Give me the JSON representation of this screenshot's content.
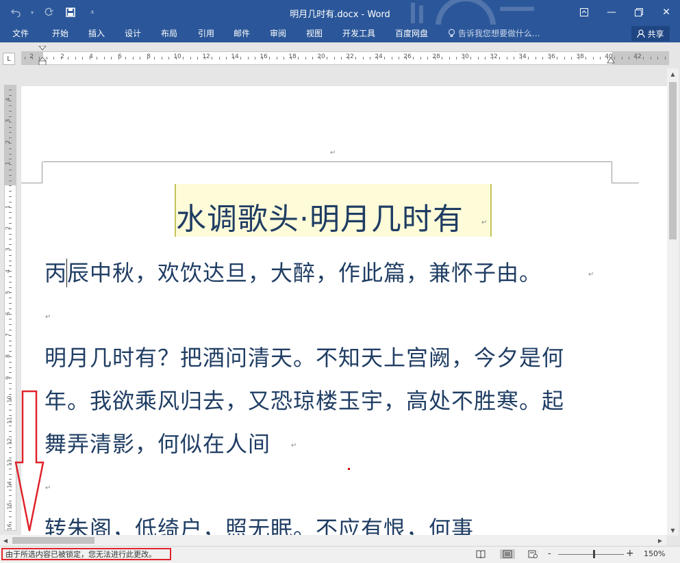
{
  "window": {
    "title": "明月几时有.docx - Word",
    "accent": "#2b579a"
  },
  "quick_access": [
    {
      "name": "undo",
      "icon": "undo-icon"
    },
    {
      "name": "redo",
      "icon": "redo-icon"
    },
    {
      "name": "save",
      "icon": "save-icon"
    },
    {
      "name": "customize",
      "icon": "chevron-down-icon"
    }
  ],
  "ribbon": {
    "tabs": [
      {
        "label": "文件"
      },
      {
        "label": "开始"
      },
      {
        "label": "插入"
      },
      {
        "label": "设计"
      },
      {
        "label": "布局"
      },
      {
        "label": "引用"
      },
      {
        "label": "邮件"
      },
      {
        "label": "审阅"
      },
      {
        "label": "视图"
      },
      {
        "label": "开发工具"
      },
      {
        "label": "百度网盘"
      }
    ],
    "tell_me": "告诉我您想要做什么...",
    "share": "共享"
  },
  "ruler": {
    "h_labels": [
      "2",
      "2",
      "4",
      "6",
      "8",
      "10",
      "12",
      "14",
      "16",
      "18",
      "20",
      "22",
      "24",
      "26",
      "28",
      "30",
      "32",
      "34",
      "36",
      "38",
      "40",
      "42"
    ],
    "v_labels_top": [
      "4",
      "3",
      "2",
      "1"
    ],
    "v_labels": [
      "1",
      "2",
      "3",
      "4",
      "5",
      "6",
      "7",
      "8",
      "9",
      "10",
      "11",
      "12",
      "13",
      "14",
      "15",
      "16"
    ]
  },
  "document": {
    "title": "水调歌头·明月几时有",
    "lines": [
      "丙辰中秋，欢饮达旦，大醉，作此篇，兼怀子由。",
      "明月几时有？把酒问清天。不知天上宫阙，今夕是何",
      "年。我欲乘风归去，又恐琼楼玉宇，高处不胜寒。起",
      "舞弄清影，何似在人间",
      "转朱阁，低绮户，照无眠。不应有恨，何事"
    ],
    "para_mark": "↵"
  },
  "status": {
    "message": "由于所选内容已被锁定，您无法进行此更改。",
    "zoom": "150%",
    "zoom_minus": "-",
    "zoom_plus": "+"
  }
}
